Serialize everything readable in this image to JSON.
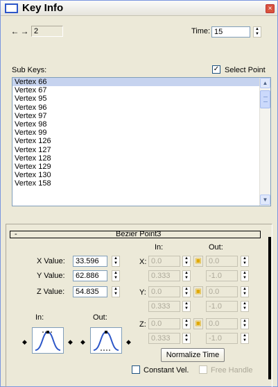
{
  "window": {
    "title": "Key Info",
    "close_glyph": "×"
  },
  "toolbar": {
    "key_number": "2",
    "time_label": "Time:",
    "time_value": "15"
  },
  "subkeys": {
    "label": "Sub Keys:",
    "select_point_label": "Select Point",
    "select_point_checked": true,
    "items": [
      "Vertex 66",
      "Vertex 67",
      "Vertex 95",
      "Vertex 96",
      "Vertex 97",
      "Vertex 98",
      "Vertex 99",
      "Vertex 126",
      "Vertex 127",
      "Vertex 128",
      "Vertex 129",
      "Vertex 130",
      "Vertex 158"
    ],
    "selected_index": 0
  },
  "bezier": {
    "rollout_sign": "-",
    "rollout_title": "Bezier Point3",
    "x_label": "X Value:",
    "x_value": "33.596",
    "y_label": "Y Value:",
    "y_value": "62.886",
    "z_label": "Z Value:",
    "z_value": "54.835",
    "in_label": "In:",
    "out_label": "Out:",
    "tangent_in_header": "In:",
    "tangent_out_header": "Out:",
    "axis_x": "X:",
    "axis_y": "Y:",
    "axis_z": "Z:",
    "x_in": "0.0",
    "x_in_len": "0.333",
    "x_out": "0.0",
    "x_out_len": "-1.0",
    "y_in": "0.0",
    "y_in_len": "0.333",
    "y_out": "0.0",
    "y_out_len": "-1.0",
    "z_in": "0.0",
    "z_in_len": "0.333",
    "z_out": "0.0",
    "z_out_len": "-1.0",
    "normalize_label": "Normalize Time",
    "constant_vel_label": "Constant Vel.",
    "free_handle_label": "Free Handle"
  },
  "colors": {
    "titlebar_icon": "#2c56c8",
    "selection": "#c6d3ef",
    "lock": "#e0a800",
    "close": "#d9533c"
  }
}
